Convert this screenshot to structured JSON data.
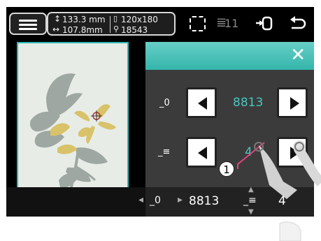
{
  "topbar": {
    "height_value": "133.3 mm",
    "width_value": "107.8mm",
    "hoop_size": "120x180",
    "stitch_count": "18543",
    "color_count": "11"
  },
  "panel": {
    "thread_label": "_0",
    "bobbin_label": "_≡",
    "thread_value": "8813",
    "bobbin_value": "4"
  },
  "bottom": {
    "thread_value": "8813",
    "bobbin_value": "4"
  },
  "callout": {
    "number": "1"
  },
  "colors": {
    "accent": "#2db7b2",
    "value": "#48c6bd",
    "close_bar": "#4fc2b9",
    "callout_line": "#e0457f"
  }
}
